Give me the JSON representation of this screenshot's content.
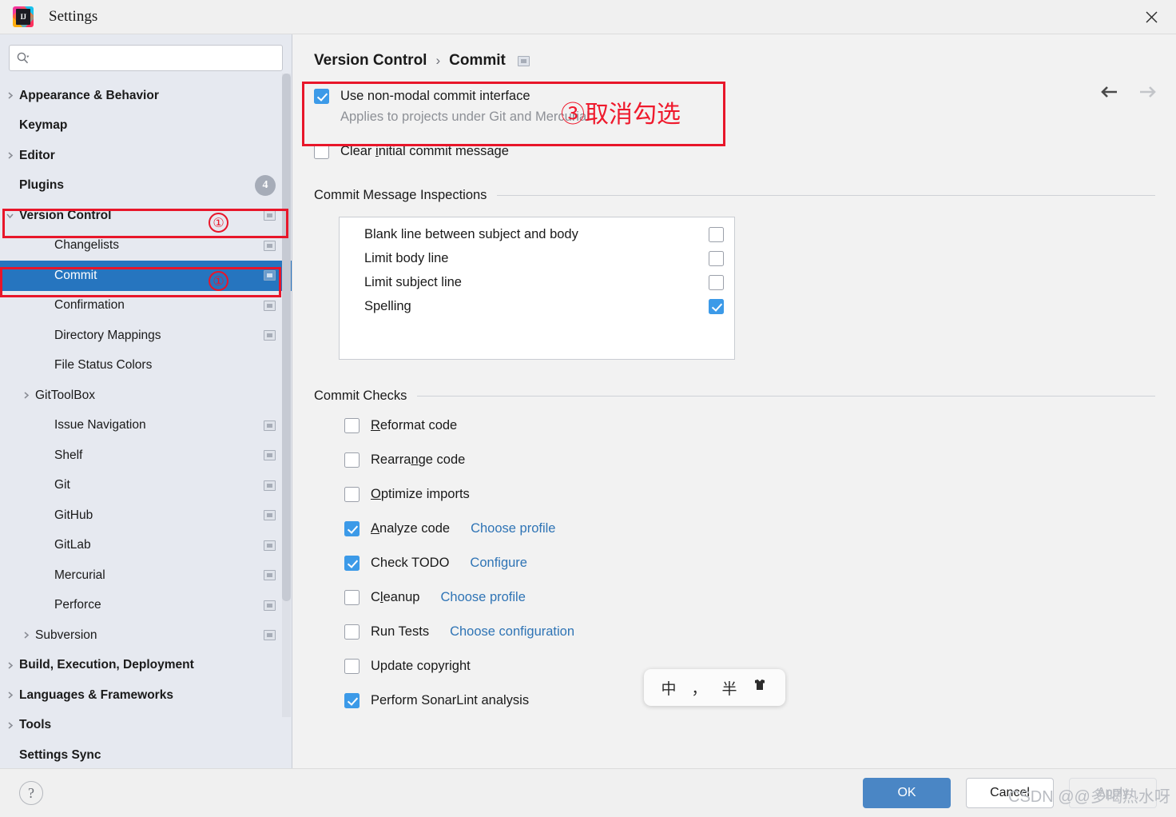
{
  "window": {
    "title": "Settings",
    "logo_icon": "intellij-idea-logo",
    "logo_text": "IJ",
    "close_icon": "close-icon"
  },
  "search": {
    "value": "",
    "placeholder": "",
    "icon": "search-icon"
  },
  "sidebar": {
    "items": [
      {
        "label": "Appearance & Behavior",
        "level": 0,
        "chevron": "right",
        "bold": true,
        "trailing": "none"
      },
      {
        "label": "Keymap",
        "level": 0,
        "chevron": "none",
        "bold": true,
        "trailing": "none"
      },
      {
        "label": "Editor",
        "level": 0,
        "chevron": "right",
        "bold": true,
        "trailing": "none"
      },
      {
        "label": "Plugins",
        "level": 0,
        "chevron": "none",
        "bold": true,
        "trailing": "badge",
        "badge": "4"
      },
      {
        "label": "Version Control",
        "level": 0,
        "chevron": "down",
        "bold": true,
        "trailing": "window",
        "marker": "1"
      },
      {
        "label": "Changelists",
        "level": 1,
        "chevron": "none",
        "bold": false,
        "trailing": "window"
      },
      {
        "label": "Commit",
        "level": 1,
        "chevron": "none",
        "bold": false,
        "trailing": "window",
        "selected": true,
        "marker": "2"
      },
      {
        "label": "Confirmation",
        "level": 1,
        "chevron": "none",
        "bold": false,
        "trailing": "window"
      },
      {
        "label": "Directory Mappings",
        "level": 1,
        "chevron": "none",
        "bold": false,
        "trailing": "window"
      },
      {
        "label": "File Status Colors",
        "level": 1,
        "chevron": "none",
        "bold": false,
        "trailing": "none"
      },
      {
        "label": "GitToolBox",
        "level": 1,
        "chevron": "right",
        "bold": false,
        "trailing": "none"
      },
      {
        "label": "Issue Navigation",
        "level": 1,
        "chevron": "none",
        "bold": false,
        "trailing": "window"
      },
      {
        "label": "Shelf",
        "level": 1,
        "chevron": "none",
        "bold": false,
        "trailing": "window"
      },
      {
        "label": "Git",
        "level": 1,
        "chevron": "none",
        "bold": false,
        "trailing": "window"
      },
      {
        "label": "GitHub",
        "level": 1,
        "chevron": "none",
        "bold": false,
        "trailing": "window"
      },
      {
        "label": "GitLab",
        "level": 1,
        "chevron": "none",
        "bold": false,
        "trailing": "window"
      },
      {
        "label": "Mercurial",
        "level": 1,
        "chevron": "none",
        "bold": false,
        "trailing": "window"
      },
      {
        "label": "Perforce",
        "level": 1,
        "chevron": "none",
        "bold": false,
        "trailing": "window"
      },
      {
        "label": "Subversion",
        "level": 1,
        "chevron": "right",
        "bold": false,
        "trailing": "window"
      },
      {
        "label": "Build, Execution, Deployment",
        "level": 0,
        "chevron": "right",
        "bold": true,
        "trailing": "none"
      },
      {
        "label": "Languages & Frameworks",
        "level": 0,
        "chevron": "right",
        "bold": true,
        "trailing": "none"
      },
      {
        "label": "Tools",
        "level": 0,
        "chevron": "right",
        "bold": true,
        "trailing": "none"
      },
      {
        "label": "Settings Sync",
        "level": 0,
        "chevron": "none",
        "bold": true,
        "trailing": "none"
      }
    ]
  },
  "breadcrumb": {
    "parent": "Version Control",
    "separator": "›",
    "current": "Commit",
    "icon": "window-restore-icon"
  },
  "nav": {
    "back_icon": "arrow-left-icon",
    "forward_icon": "arrow-right-icon"
  },
  "main": {
    "non_modal": {
      "label": "Use non-modal commit interface",
      "checked": true,
      "note": "Applies to projects under Git and Mercurial"
    },
    "clear_initial": {
      "label_pre": "Clear ",
      "mnemonic": "i",
      "label_post": "nitial commit message",
      "checked": false
    },
    "inspections": {
      "title": "Commit Message Inspections",
      "rows": [
        {
          "name": "Blank line between subject and body",
          "checked": false
        },
        {
          "name": "Limit body line",
          "checked": false
        },
        {
          "name": "Limit subject line",
          "checked": false
        },
        {
          "name": "Spelling",
          "checked": true
        }
      ]
    },
    "checks": {
      "title": "Commit Checks",
      "rows": [
        {
          "pre": "",
          "mnemonic": "R",
          "post": "eformat code",
          "checked": false,
          "link": ""
        },
        {
          "pre": "Rearra",
          "mnemonic": "n",
          "post": "ge code",
          "checked": false,
          "link": ""
        },
        {
          "pre": "",
          "mnemonic": "O",
          "post": "ptimize imports",
          "checked": false,
          "link": ""
        },
        {
          "pre": "",
          "mnemonic": "A",
          "post": "nalyze code",
          "checked": true,
          "link": "Choose profile"
        },
        {
          "pre": "Check TODO",
          "mnemonic": "",
          "post": "",
          "checked": true,
          "link": "Configure"
        },
        {
          "pre": "C",
          "mnemonic": "l",
          "post": "eanup",
          "checked": false,
          "link": "Choose profile"
        },
        {
          "pre": "Run Tests",
          "mnemonic": "",
          "post": "",
          "checked": false,
          "link": "Choose configuration"
        },
        {
          "pre": "Update copyright",
          "mnemonic": "",
          "post": "",
          "checked": false,
          "link": ""
        },
        {
          "pre": "Perform SonarLint analysis",
          "mnemonic": "",
          "post": "",
          "checked": true,
          "link": ""
        }
      ]
    }
  },
  "ime": {
    "mode": "中",
    "punctuation": "，",
    "width": "半",
    "shirt_icon": "shirt-icon",
    "shirt_glyph": "👕"
  },
  "footer": {
    "help_icon": "help-icon",
    "help_label": "?",
    "ok": "OK",
    "cancel": "Cancel",
    "apply": "Apply"
  },
  "annotations": {
    "marker1": "①",
    "marker2": "②",
    "step3_text": "③取消勾选",
    "accent_red": "#e8162a"
  },
  "watermark": "CSDN @@多喝热水呀"
}
